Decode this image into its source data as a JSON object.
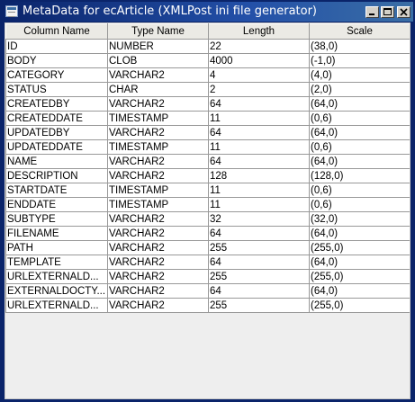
{
  "window": {
    "title": "MetaData for ecArticle (XMLPost ini file generator)"
  },
  "table": {
    "headers": [
      "Column Name",
      "Type Name",
      "Length",
      "Scale"
    ],
    "rows": [
      [
        "ID",
        "NUMBER",
        "22",
        "(38,0)"
      ],
      [
        "BODY",
        "CLOB",
        "4000",
        "(-1,0)"
      ],
      [
        "CATEGORY",
        "VARCHAR2",
        "4",
        "(4,0)"
      ],
      [
        "STATUS",
        "CHAR",
        "2",
        "(2,0)"
      ],
      [
        "CREATEDBY",
        "VARCHAR2",
        "64",
        "(64,0)"
      ],
      [
        "CREATEDDATE",
        "TIMESTAMP",
        "11",
        "(0,6)"
      ],
      [
        "UPDATEDBY",
        "VARCHAR2",
        "64",
        "(64,0)"
      ],
      [
        "UPDATEDDATE",
        "TIMESTAMP",
        "11",
        "(0,6)"
      ],
      [
        "NAME",
        "VARCHAR2",
        "64",
        "(64,0)"
      ],
      [
        "DESCRIPTION",
        "VARCHAR2",
        "128",
        "(128,0)"
      ],
      [
        "STARTDATE",
        "TIMESTAMP",
        "11",
        "(0,6)"
      ],
      [
        "ENDDATE",
        "TIMESTAMP",
        "11",
        "(0,6)"
      ],
      [
        "SUBTYPE",
        "VARCHAR2",
        "32",
        "(32,0)"
      ],
      [
        "FILENAME",
        "VARCHAR2",
        "64",
        "(64,0)"
      ],
      [
        "PATH",
        "VARCHAR2",
        "255",
        "(255,0)"
      ],
      [
        "TEMPLATE",
        "VARCHAR2",
        "64",
        "(64,0)"
      ],
      [
        "URLEXTERNALD...",
        "VARCHAR2",
        "255",
        "(255,0)"
      ],
      [
        "EXTERNALDOCTY...",
        "VARCHAR2",
        "64",
        "(64,0)"
      ],
      [
        "URLEXTERNALD...",
        "VARCHAR2",
        "255",
        "(255,0)"
      ]
    ]
  },
  "icons": {
    "app": "window-app-icon",
    "minimize": "minimize-icon",
    "maximize": "maximize-icon",
    "close": "close-icon"
  },
  "colors": {
    "titlebar_start": "#0a246a",
    "titlebar_end": "#3a6ea5",
    "grid": "#999999",
    "header_bg": "#ebeae5",
    "empty_area": "#eeeeee"
  }
}
